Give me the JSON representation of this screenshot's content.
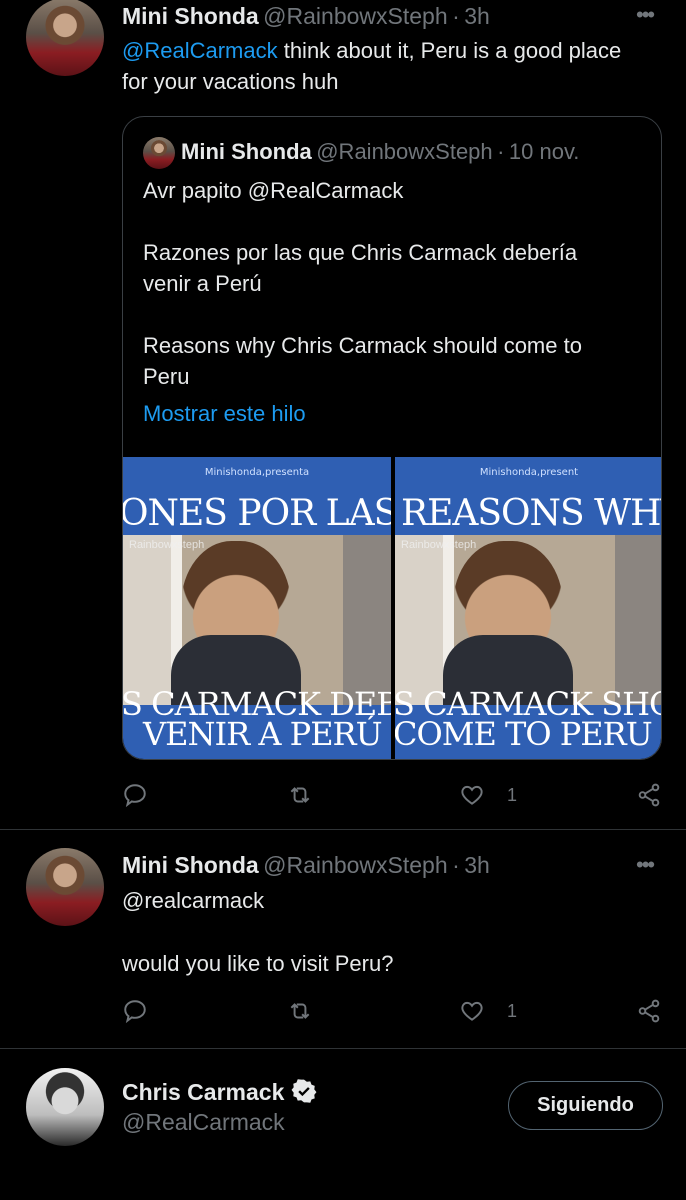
{
  "tweet1": {
    "author_name": "Mini Shonda",
    "author_handle": "@RainbowxSteph",
    "separator": "·",
    "time": "3h",
    "mention": "@RealCarmack",
    "text_line1_rest": " think about it, Peru is a good place",
    "text_line2": "for your vacations huh",
    "quote": {
      "author_name": "Mini Shonda",
      "author_handle": "@RainbowxSteph",
      "separator": "·",
      "time": "10 nov.",
      "line1": "Avr papito @RealCarmack",
      "para2_line1": "Razones por las que Chris Carmack debería",
      "para2_line2": "venir a Perú",
      "para3_line1": "Reasons why Chris Carmack should come to",
      "para3_line2": "Peru",
      "show_thread": "Mostrar este hilo",
      "images": [
        {
          "small_caption": "Minishonda,presenta",
          "top_text": "ONES POR LAS Q",
          "watermark": "Rainbowxsteph",
          "bottom_line1": "S CARMACK DEB",
          "bottom_line2": "VENIR A PERÚ"
        },
        {
          "small_caption": "Minishonda,present",
          "top_text": "REASONS WHY",
          "watermark": "Rainbowxsteph",
          "bottom_line1": "S CARMACK SHO",
          "bottom_line2": "COME TO PERU"
        }
      ]
    },
    "actions": {
      "reply_count": "",
      "retweet_count": "",
      "like_count": "1"
    }
  },
  "tweet2": {
    "author_name": "Mini Shonda",
    "author_handle": "@RainbowxSteph",
    "separator": "·",
    "time": "3h",
    "mention": "@realcarmack",
    "text": "would you like to visit Peru?",
    "actions": {
      "reply_count": "",
      "retweet_count": "",
      "like_count": "1"
    }
  },
  "profile_card": {
    "name": "Chris Carmack",
    "handle": "@RealCarmack",
    "follow_label": "Siguiendo"
  },
  "colors": {
    "background": "#000000",
    "accent": "#1d9bf0",
    "muted": "#71767b",
    "text": "#e7e9ea",
    "image_blue": "#2f5fb3"
  }
}
